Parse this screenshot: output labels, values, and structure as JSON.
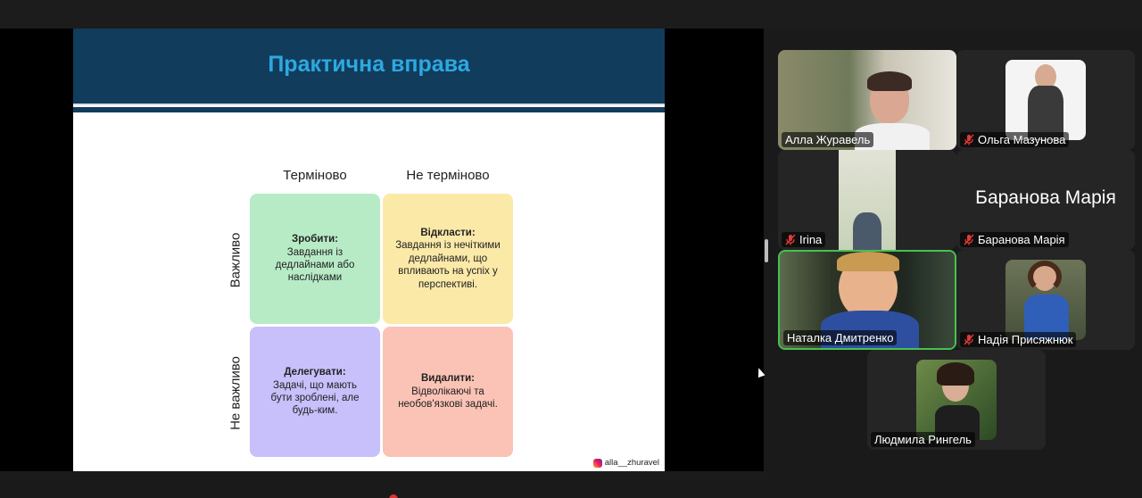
{
  "slide": {
    "title": "Практична вправа",
    "col_urgent": "Терміново",
    "col_not_urgent": "Не терміново",
    "row_important": "Важливо",
    "row_not_important": "Не важливо",
    "cells": [
      {
        "title": "Зробити:",
        "body": "Завдання із дедлайнами або наслідками",
        "color": "#b7ebc6"
      },
      {
        "title": "Відкласти:",
        "body": "Завдання із нечіткими дедлайнами, що впливають на успіх у перспективі.",
        "color": "#fbe9a8"
      },
      {
        "title": "Делегувати:",
        "body": "Задачі, що мають бути зроблені, але будь-ким.",
        "color": "#c7c0fb"
      },
      {
        "title": "Видалити:",
        "body": "Відволікаючі та необов'язкові задачі.",
        "color": "#fbc3b5"
      }
    ],
    "handle": "alla__zhuravel"
  },
  "participants": [
    {
      "name": "Алла Журавель",
      "muted": false
    },
    {
      "name": "Ольга Мазунова",
      "muted": true
    },
    {
      "name": "Irina",
      "muted": true
    },
    {
      "name": "Баранова Марія",
      "muted": true,
      "big_name": "Баранова Марія"
    },
    {
      "name": "Наталка Дмитренко",
      "muted": false,
      "active": true
    },
    {
      "name": "Надія Присяжнюк",
      "muted": true
    },
    {
      "name": "Людмила Рингель",
      "muted": false
    }
  ],
  "colors": {
    "header": "#113c5c",
    "title": "#2ea8e0",
    "active_border": "#47c150",
    "mute": "#e53935"
  }
}
